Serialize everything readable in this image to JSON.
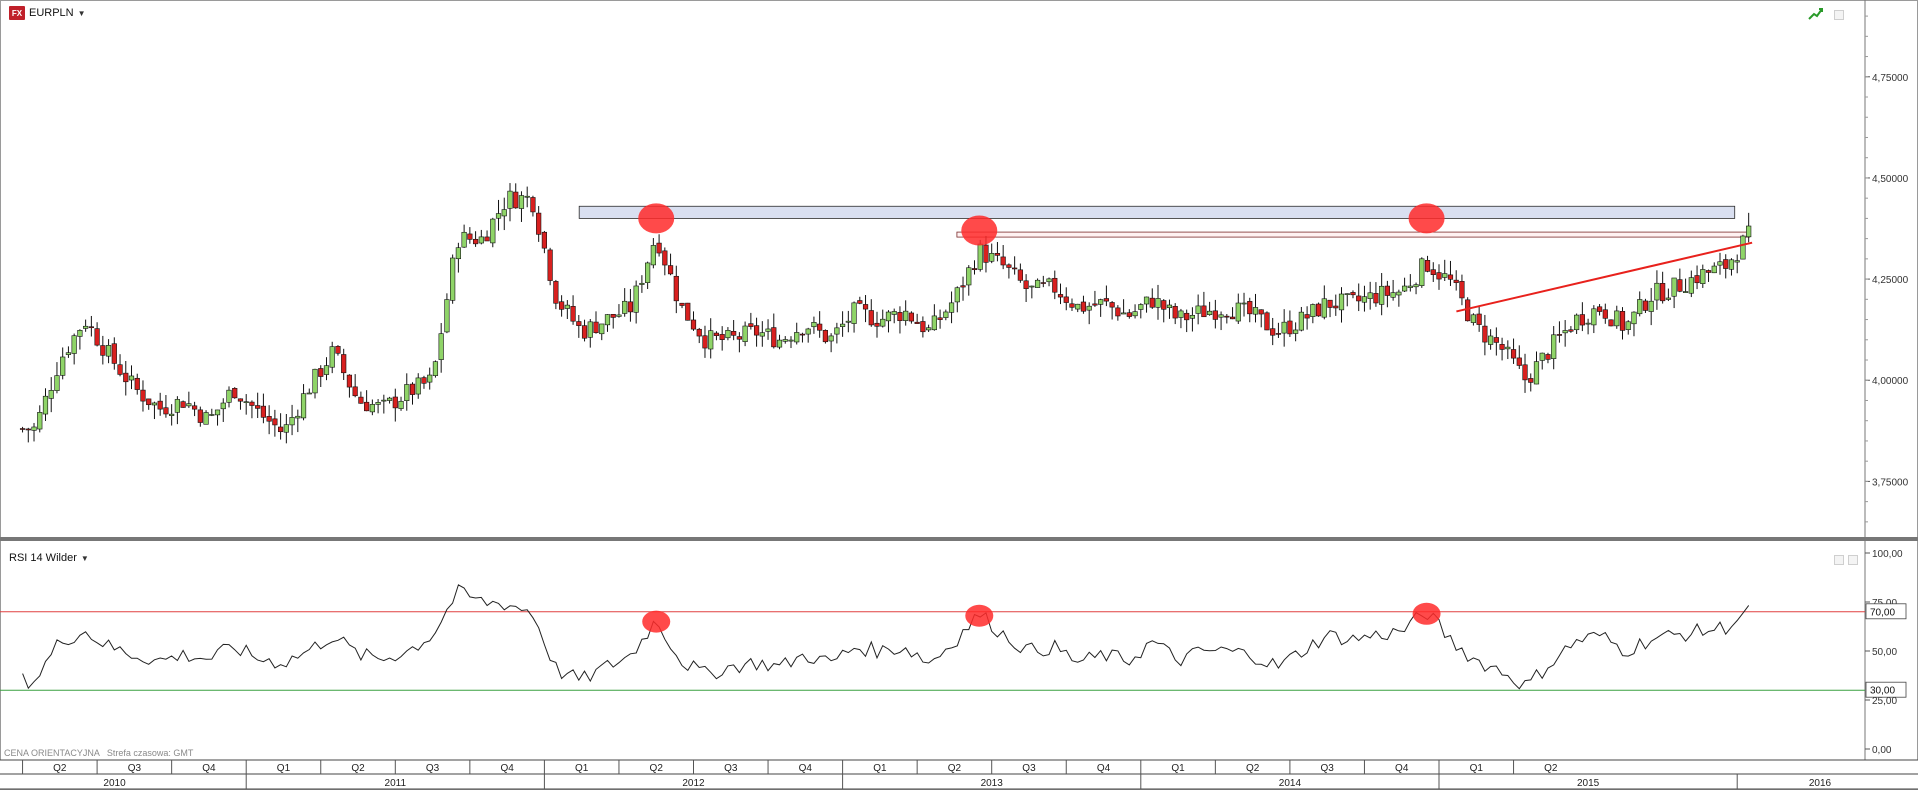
{
  "header": {
    "logo": "FX",
    "symbol": "EURPLN"
  },
  "rsi_panel": {
    "label": "RSI 14 Wilder"
  },
  "footer": {
    "price_note": "CENA ORIENTACYJNA",
    "timezone": "Strefa czasowa: GMT"
  },
  "icons": {
    "trend_toggle": "trend-line-icon",
    "panel_button": "window-icon",
    "dropdown": "caret-down-icon"
  },
  "colors": {
    "up_candle": "#8fd468",
    "down_candle": "#d8201f",
    "resistance_zone": "#d9dff0",
    "trend_line": "#e8211c",
    "highlight": "#ff2a2a",
    "rsi_upper": "#e04040",
    "rsi_lower": "#3aa040",
    "rsi_line": "#222222"
  },
  "chart_data": [
    {
      "type": "candlestick",
      "symbol": "EURPLN",
      "ylim": [
        3.62,
        4.92
      ],
      "y_ticks": [
        "4,75000",
        "4,50000",
        "4,25000",
        "4,00000",
        "3,75000"
      ],
      "y_tick_values": [
        4.75,
        4.5,
        4.25,
        4.0,
        3.75
      ],
      "x_quarters": [
        "Q2",
        "Q3",
        "Q4",
        "Q1",
        "Q2",
        "Q3",
        "Q4",
        "Q1",
        "Q2",
        "Q3",
        "Q4",
        "Q1",
        "Q2",
        "Q3",
        "Q4",
        "Q1",
        "Q2",
        "Q3",
        "Q4",
        "Q1",
        "Q2"
      ],
      "x_years": [
        "2010",
        "2011",
        "2012",
        "2013",
        "2014",
        "2015",
        "2016"
      ],
      "close_anchors": [
        [
          "2010-04",
          3.88
        ],
        [
          "2010-05",
          4.05
        ],
        [
          "2010-06",
          4.15
        ],
        [
          "2010-07",
          4.06
        ],
        [
          "2010-08",
          3.98
        ],
        [
          "2010-09",
          3.93
        ],
        [
          "2010-10",
          3.95
        ],
        [
          "2010-11",
          3.9
        ],
        [
          "2010-12",
          3.98
        ],
        [
          "2011-01",
          3.92
        ],
        [
          "2011-02",
          3.87
        ],
        [
          "2011-03",
          3.98
        ],
        [
          "2011-04",
          4.07
        ],
        [
          "2011-05",
          3.95
        ],
        [
          "2011-06",
          3.93
        ],
        [
          "2011-07",
          3.97
        ],
        [
          "2011-08",
          4.0
        ],
        [
          "2011-09",
          4.35
        ],
        [
          "2011-10",
          4.35
        ],
        [
          "2011-11",
          4.45
        ],
        [
          "2011-12",
          4.45
        ],
        [
          "2012-01",
          4.2
        ],
        [
          "2012-02",
          4.12
        ],
        [
          "2012-03",
          4.15
        ],
        [
          "2012-04",
          4.18
        ],
        [
          "2012-05",
          4.36
        ],
        [
          "2012-06",
          4.18
        ],
        [
          "2012-07",
          4.1
        ],
        [
          "2012-08",
          4.1
        ],
        [
          "2012-09",
          4.12
        ],
        [
          "2012-10",
          4.1
        ],
        [
          "2012-11",
          4.14
        ],
        [
          "2012-12",
          4.1
        ],
        [
          "2013-01",
          4.17
        ],
        [
          "2013-02",
          4.15
        ],
        [
          "2013-03",
          4.17
        ],
        [
          "2013-04",
          4.12
        ],
        [
          "2013-05",
          4.2
        ],
        [
          "2013-06",
          4.32
        ],
        [
          "2013-07",
          4.28
        ],
        [
          "2013-08",
          4.22
        ],
        [
          "2013-09",
          4.23
        ],
        [
          "2013-10",
          4.18
        ],
        [
          "2013-11",
          4.19
        ],
        [
          "2013-12",
          4.16
        ],
        [
          "2014-01",
          4.2
        ],
        [
          "2014-02",
          4.15
        ],
        [
          "2014-03",
          4.17
        ],
        [
          "2014-04",
          4.18
        ],
        [
          "2014-05",
          4.16
        ],
        [
          "2014-06",
          4.12
        ],
        [
          "2014-07",
          4.15
        ],
        [
          "2014-08",
          4.19
        ],
        [
          "2014-09",
          4.19
        ],
        [
          "2014-10",
          4.21
        ],
        [
          "2014-11",
          4.22
        ],
        [
          "2014-12",
          4.29
        ],
        [
          "2015-01",
          4.24
        ],
        [
          "2015-02",
          4.13
        ],
        [
          "2015-03",
          4.08
        ],
        [
          "2015-04",
          4.0
        ],
        [
          "2015-05",
          4.08
        ],
        [
          "2015-06",
          4.15
        ],
        [
          "2015-07",
          4.18
        ],
        [
          "2015-08",
          4.13
        ],
        [
          "2015-09",
          4.21
        ],
        [
          "2015-10",
          4.23
        ],
        [
          "2015-11",
          4.26
        ],
        [
          "2015-12",
          4.28
        ],
        [
          "2016-01",
          4.36
        ]
      ],
      "highs": [
        {
          "date": "2012-05",
          "value": 4.4
        },
        {
          "date": "2013-06",
          "value": 4.37
        },
        {
          "date": "2014-12",
          "value": 4.4
        }
      ],
      "resistance_zone": [
        4.4,
        4.43
      ],
      "resistance_line": 4.36,
      "trend_line": {
        "start": [
          "2015-01",
          4.17
        ],
        "end": [
          "2016-01",
          4.34
        ]
      }
    },
    {
      "type": "line",
      "name": "RSI 14 Wilder",
      "ylim": [
        0,
        100
      ],
      "y_ticks": [
        "100,00",
        "75,00",
        "50,00",
        "25,00",
        "0,00"
      ],
      "y_tick_values": [
        100,
        75,
        50,
        25,
        0
      ],
      "levels": [
        {
          "value": 70,
          "label": "70,00"
        },
        {
          "value": 30,
          "label": "30,00"
        }
      ],
      "anchors": [
        [
          "2010-04",
          35
        ],
        [
          "2010-05",
          55
        ],
        [
          "2010-06",
          60
        ],
        [
          "2010-07",
          52
        ],
        [
          "2010-08",
          48
        ],
        [
          "2010-09",
          45
        ],
        [
          "2010-10",
          48
        ],
        [
          "2010-11",
          46
        ],
        [
          "2010-12",
          52
        ],
        [
          "2011-01",
          46
        ],
        [
          "2011-02",
          44
        ],
        [
          "2011-03",
          50
        ],
        [
          "2011-04",
          58
        ],
        [
          "2011-05",
          48
        ],
        [
          "2011-06",
          46
        ],
        [
          "2011-07",
          50
        ],
        [
          "2011-08",
          58
        ],
        [
          "2011-09",
          80
        ],
        [
          "2011-10",
          75
        ],
        [
          "2011-11",
          74
        ],
        [
          "2011-12",
          70
        ],
        [
          "2012-01",
          40
        ],
        [
          "2012-02",
          35
        ],
        [
          "2012-03",
          42
        ],
        [
          "2012-04",
          48
        ],
        [
          "2012-05",
          66
        ],
        [
          "2012-06",
          45
        ],
        [
          "2012-07",
          38
        ],
        [
          "2012-08",
          42
        ],
        [
          "2012-09",
          44
        ],
        [
          "2012-10",
          42
        ],
        [
          "2012-11",
          48
        ],
        [
          "2012-12",
          44
        ],
        [
          "2013-01",
          52
        ],
        [
          "2013-02",
          50
        ],
        [
          "2013-03",
          52
        ],
        [
          "2013-04",
          44
        ],
        [
          "2013-05",
          55
        ],
        [
          "2013-06",
          69
        ],
        [
          "2013-07",
          58
        ],
        [
          "2013-08",
          50
        ],
        [
          "2013-09",
          52
        ],
        [
          "2013-10",
          44
        ],
        [
          "2013-11",
          48
        ],
        [
          "2013-12",
          45
        ],
        [
          "2014-01",
          55
        ],
        [
          "2014-02",
          45
        ],
        [
          "2014-03",
          50
        ],
        [
          "2014-04",
          50
        ],
        [
          "2014-05",
          48
        ],
        [
          "2014-06",
          42
        ],
        [
          "2014-07",
          50
        ],
        [
          "2014-08",
          58
        ],
        [
          "2014-09",
          56
        ],
        [
          "2014-10",
          58
        ],
        [
          "2014-11",
          60
        ],
        [
          "2014-12",
          70
        ],
        [
          "2015-01",
          55
        ],
        [
          "2015-02",
          45
        ],
        [
          "2015-03",
          40
        ],
        [
          "2015-04",
          32
        ],
        [
          "2015-05",
          44
        ],
        [
          "2015-06",
          55
        ],
        [
          "2015-07",
          58
        ],
        [
          "2015-08",
          50
        ],
        [
          "2015-09",
          56
        ],
        [
          "2015-10",
          58
        ],
        [
          "2015-11",
          60
        ],
        [
          "2015-12",
          62
        ],
        [
          "2016-01",
          70
        ]
      ],
      "highlights": [
        {
          "date": "2012-05",
          "value": 66
        },
        {
          "date": "2013-06",
          "value": 69
        },
        {
          "date": "2014-12",
          "value": 70
        }
      ]
    }
  ]
}
